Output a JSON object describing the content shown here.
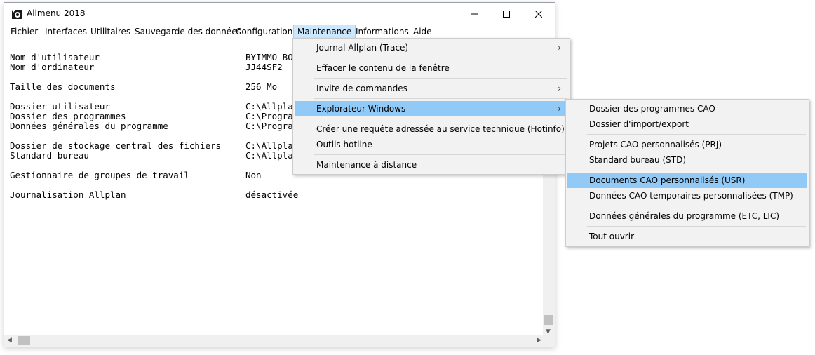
{
  "window": {
    "title": "Allmenu 2018"
  },
  "menubar": [
    "Fichier",
    "Interfaces",
    "Utilitaires",
    "Sauvegarde des données",
    "Configuration",
    "Maintenance",
    "Informations",
    "Aide"
  ],
  "info_rows": [
    {
      "label": "Nom d'utilisateur",
      "value": "BYIMMO-BO"
    },
    {
      "label": "Nom d'ordinateur",
      "value": "JJ44SF2"
    },
    {
      "label": "Taille des documents",
      "value": "256 Mo"
    },
    {
      "label": "Dossier utilisateur",
      "value": "C:\\Allpla"
    },
    {
      "label": "Dossier des programmes",
      "value": "C:\\Progra"
    },
    {
      "label": "Données générales du programme",
      "value": "C:\\Progra"
    },
    {
      "label": "Dossier de stockage central des fichiers",
      "value": "C:\\Allpla"
    },
    {
      "label": "Standard bureau",
      "value": "C:\\Allpla"
    },
    {
      "label": "Gestionnaire de groupes de travail",
      "value": "Non"
    },
    {
      "label": "Journalisation Allplan",
      "value": "désactivée"
    }
  ],
  "maintenance_menu": [
    {
      "label": "Journal Allplan (Trace)",
      "submenu": true
    },
    {
      "label": "Effacer le contenu de la fenêtre",
      "submenu": false
    },
    {
      "label": "Invite de commandes",
      "submenu": true
    },
    {
      "label": "Explorateur Windows",
      "submenu": true,
      "highlighted": true
    },
    {
      "label": "Créer une requête adressée au service technique (Hotinfo)",
      "submenu": false
    },
    {
      "label": "Outils hotline",
      "submenu": false
    },
    {
      "label": "Maintenance à distance",
      "submenu": false
    }
  ],
  "explorer_submenu": [
    {
      "label": "Dossier des programmes CAO"
    },
    {
      "label": "Dossier d'import/export"
    },
    {
      "label": "Projets CAO personnalisés (PRJ)"
    },
    {
      "label": "Standard bureau (STD)"
    },
    {
      "label": "Documents CAO personnalisés (USR)",
      "highlighted": true
    },
    {
      "label": "Données CAO temporaires personnalisées (TMP)"
    },
    {
      "label": "Données générales du programme (ETC, LIC)"
    },
    {
      "label": "Tout ouvrir"
    }
  ],
  "colors": {
    "highlight": "#91c9f7",
    "menu_active": "#cce8ff",
    "menu_bg": "#f2f2f2"
  }
}
